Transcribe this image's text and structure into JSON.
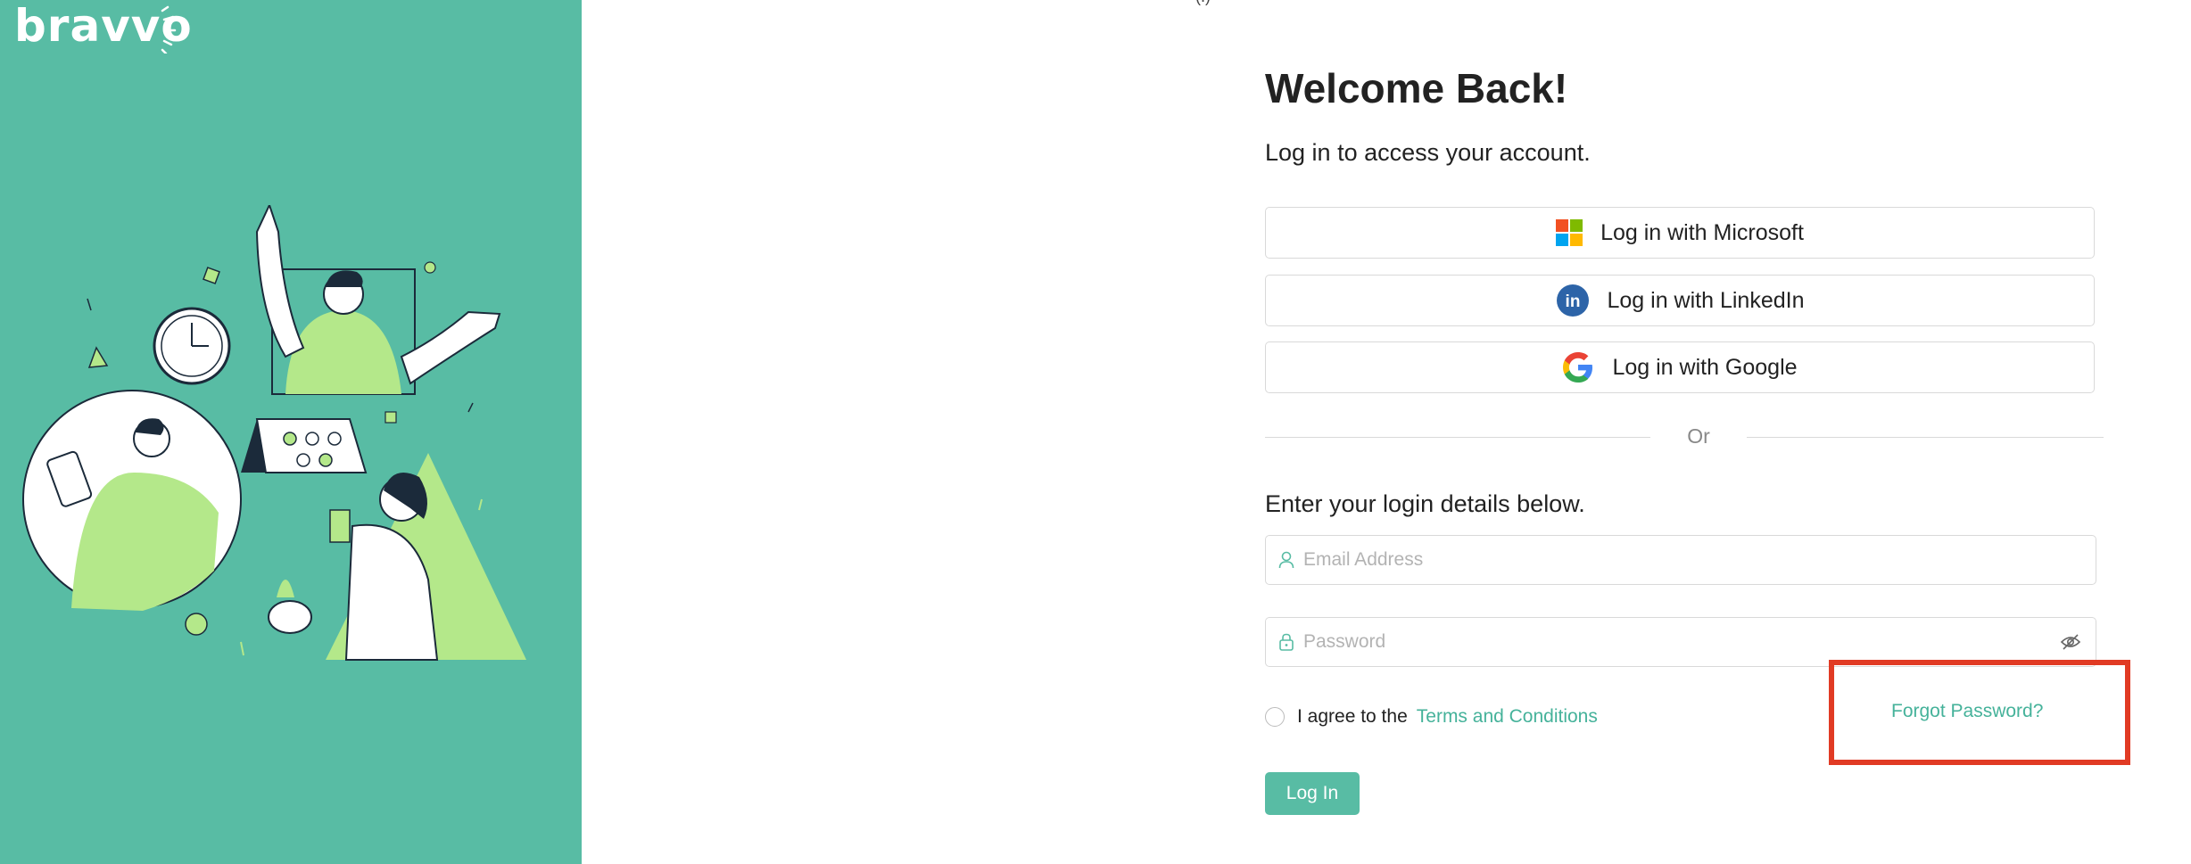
{
  "brand": {
    "logo_text": "bravvo",
    "accent": "#58bca4",
    "link_color": "#45b29a"
  },
  "top_mark": "(.)",
  "form": {
    "title": "Welcome Back!",
    "subtitle": "Log in to access your account.",
    "sso": [
      {
        "label": "Log in with Microsoft",
        "icon": "microsoft-icon"
      },
      {
        "label": "Log in with LinkedIn",
        "icon": "linkedin-icon"
      },
      {
        "label": "Log in with Google",
        "icon": "google-icon"
      }
    ],
    "divider_text": "Or",
    "login_hint": "Enter your login details below.",
    "email_placeholder": "Email Address",
    "password_placeholder": "Password",
    "agree_text": "I agree to the",
    "terms_link": "Terms and Conditions",
    "forgot_link": "Forgot Password?",
    "login_button": "Log In"
  },
  "highlight": {
    "color": "#e13b24",
    "target": "forgot-password-link"
  }
}
